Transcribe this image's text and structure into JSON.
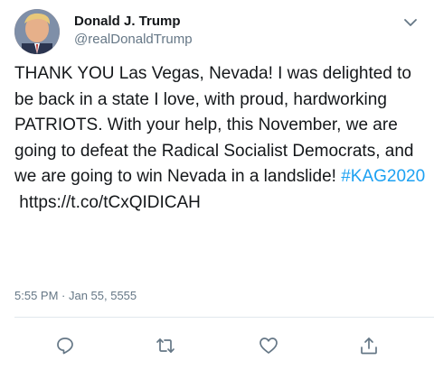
{
  "tweet": {
    "author": {
      "display_name": "Donald J. Trump",
      "handle": "@realDonaldTrump"
    },
    "text_main": "THANK YOU Las Vegas, Nevada! I was delighted to be back in a state I love, with proud, hardworking PATRIOTS. With your help, this November, we are going to defeat the Radical Socialist Democrats, and we are going to win Nevada in a landslide! ",
    "hashtag": "#KAG2020",
    "link": "https://t.co/tCxQIDICAH",
    "timestamp": "5:55 PM · Jan 55, 5555"
  },
  "icons": {
    "more": "chevron-down-icon",
    "reply": "reply-icon",
    "retweet": "retweet-icon",
    "like": "heart-icon",
    "share": "share-icon"
  },
  "colors": {
    "link_blue": "#1da1f2",
    "secondary_text": "#657786",
    "icon_gray": "#657786",
    "divider": "#e1e8ed"
  }
}
